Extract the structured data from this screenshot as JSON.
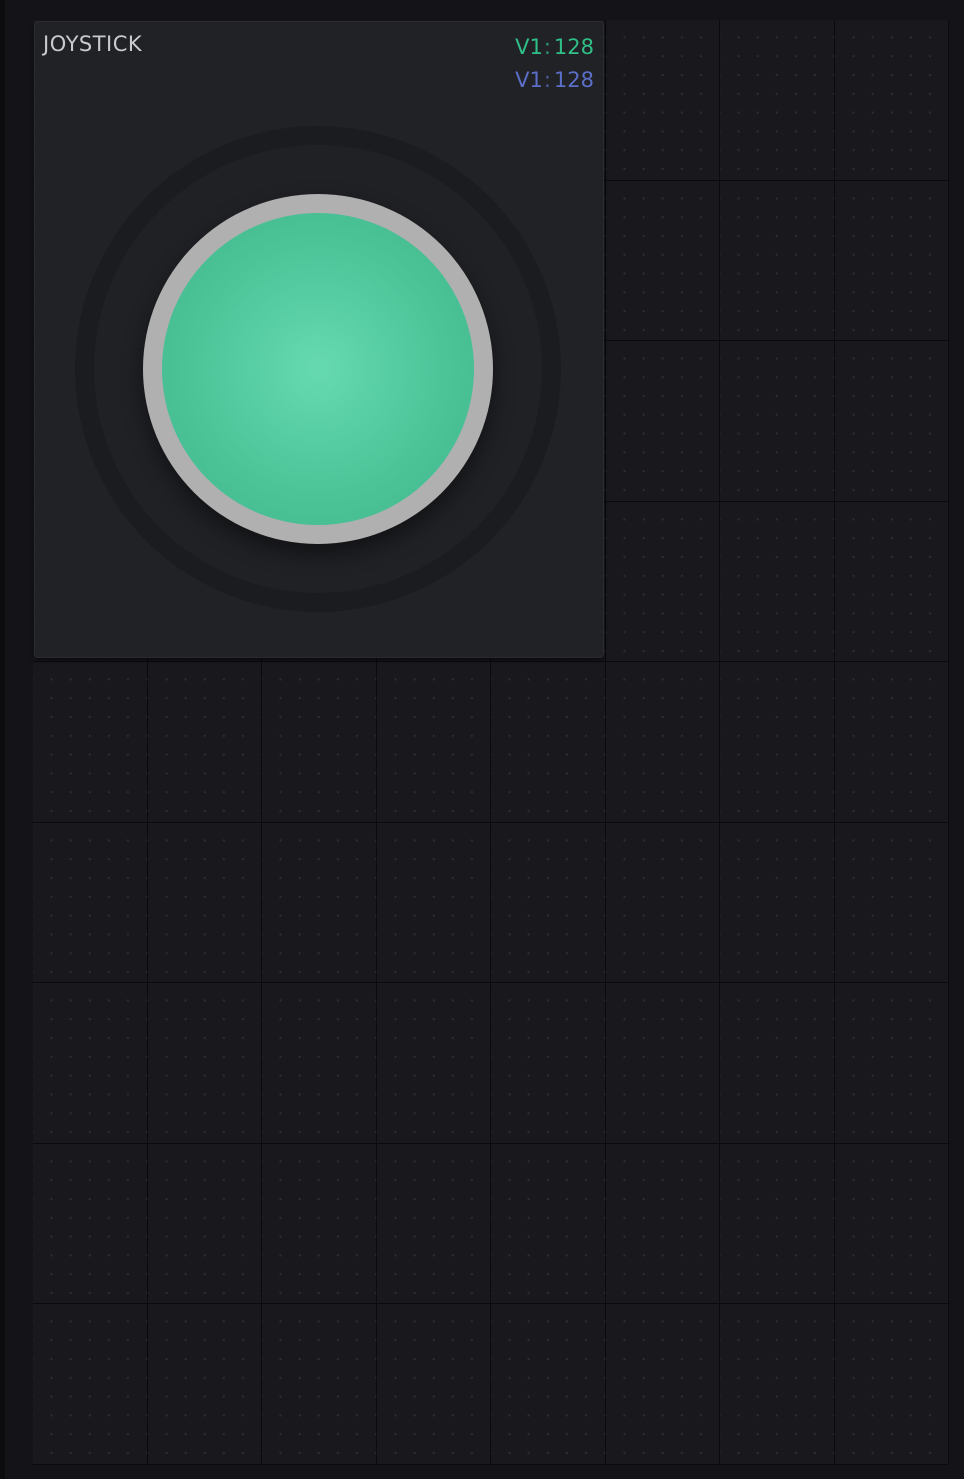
{
  "widget": {
    "title": "JOYSTICK",
    "x_axis": {
      "pin": "V1",
      "separator": ":",
      "value": "128",
      "color": "#2fbf87"
    },
    "y_axis": {
      "pin": "V1",
      "separator": ":",
      "value": "128",
      "color": "#5b6ec8"
    },
    "knob_color": "#4dc599"
  }
}
